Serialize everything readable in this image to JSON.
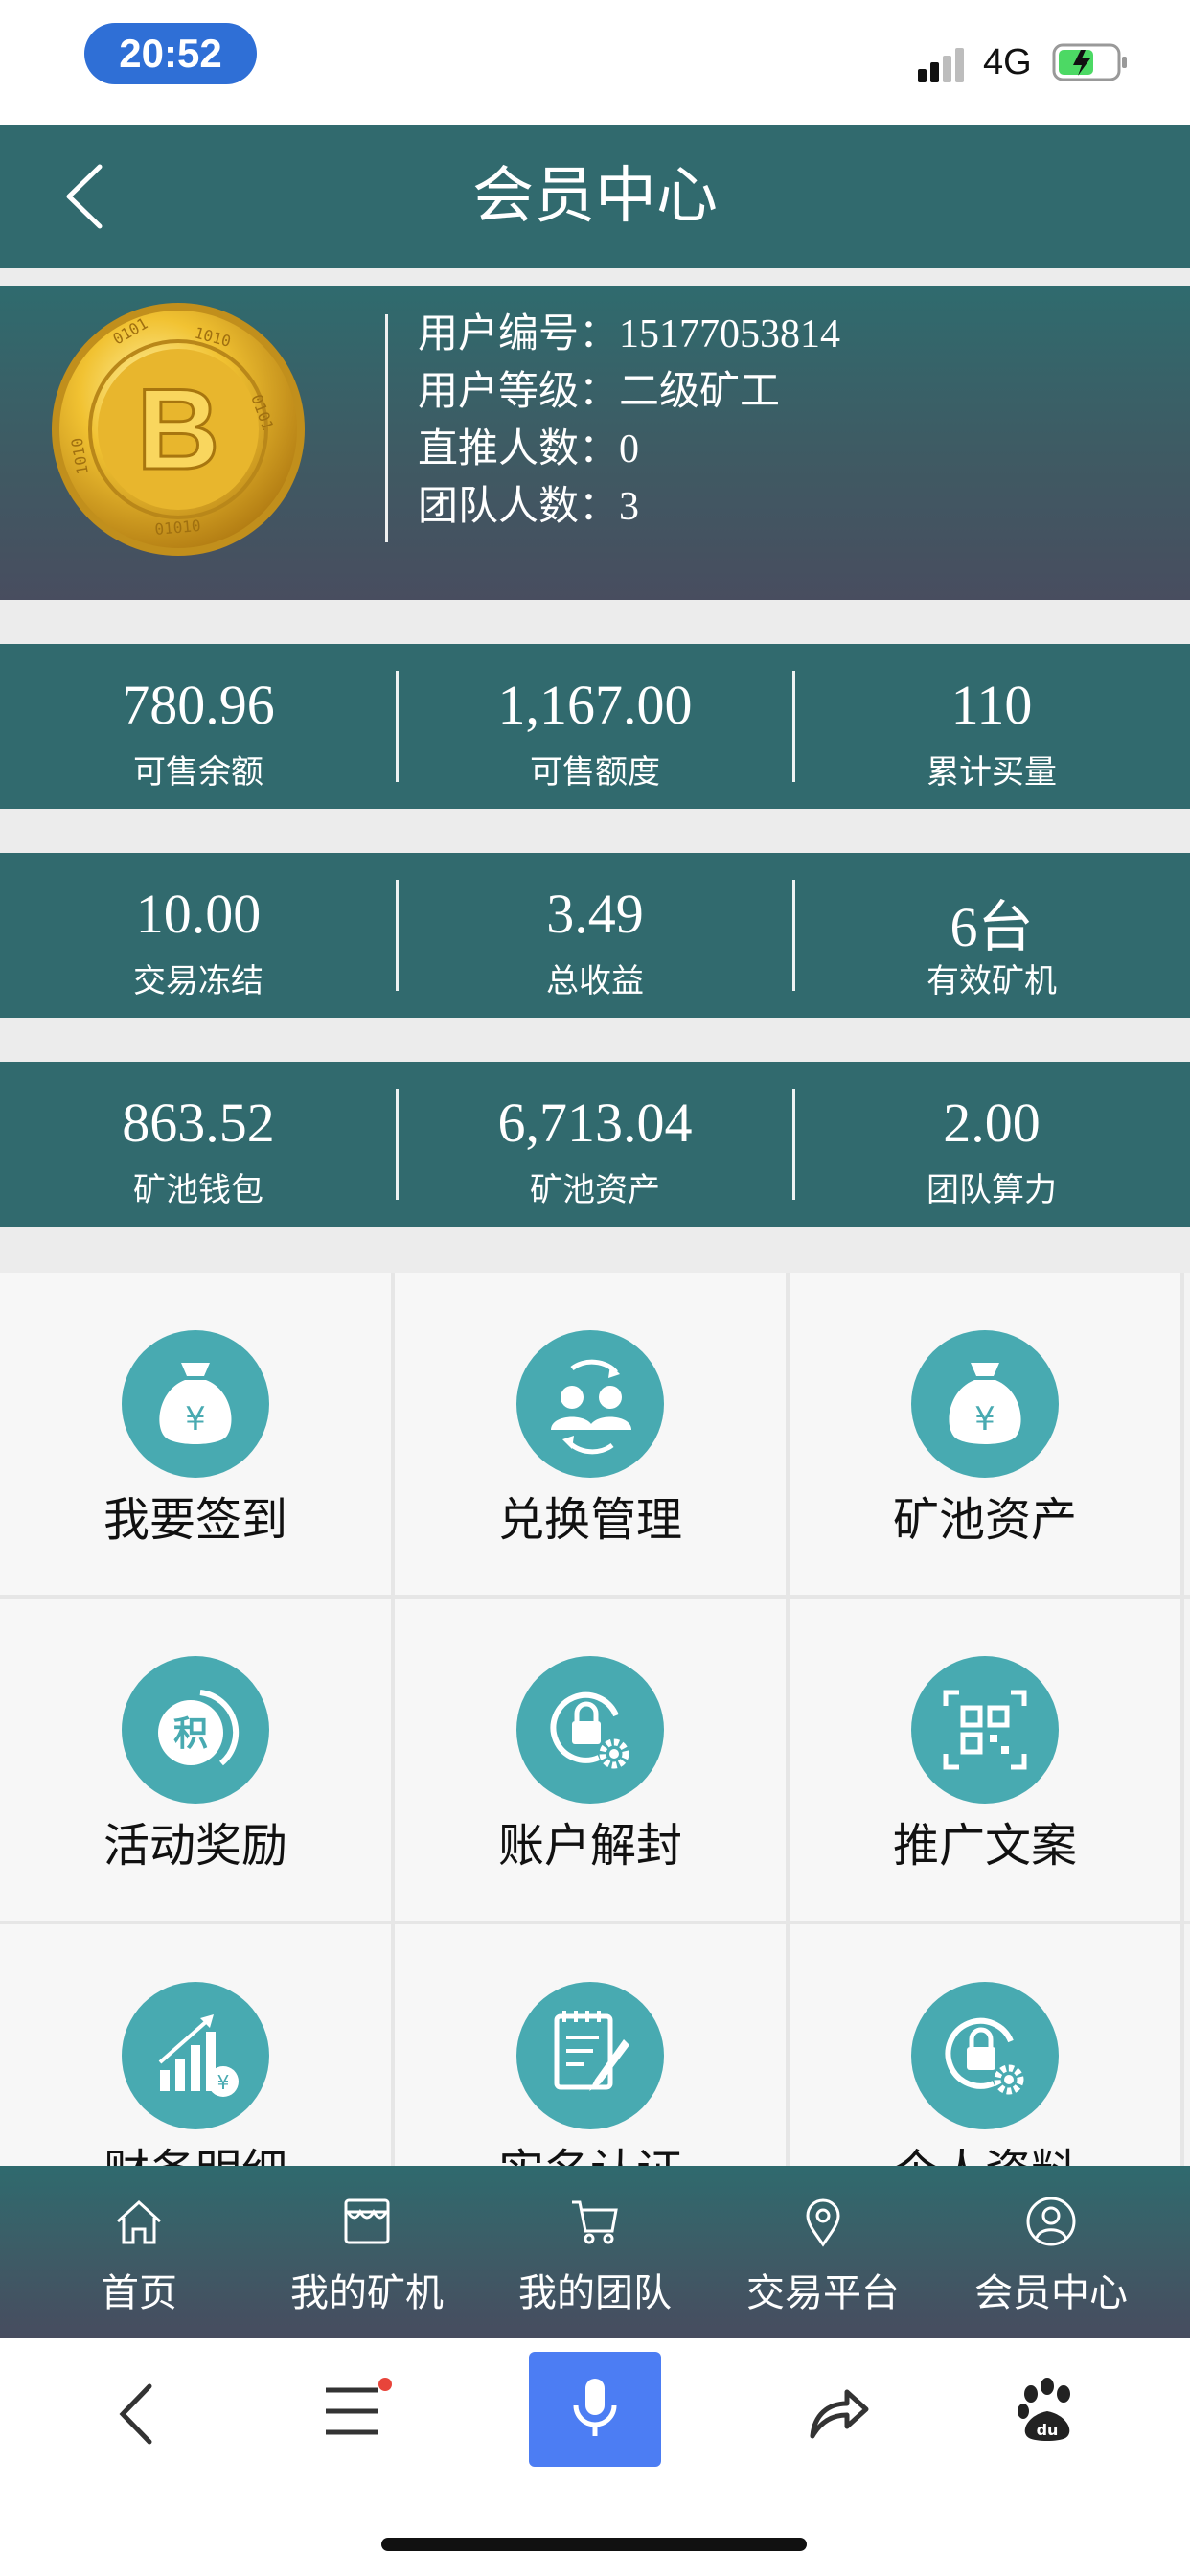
{
  "status_bar": {
    "time": "20:52",
    "network": "4G"
  },
  "header": {
    "title": "会员中心"
  },
  "profile": {
    "lines": [
      {
        "label": "用户编号：",
        "value": "15177053814"
      },
      {
        "label": "用户等级：",
        "value": "二级矿工"
      },
      {
        "label": "直推人数：",
        "value": "0"
      },
      {
        "label": "团队人数：",
        "value": "3"
      }
    ]
  },
  "stats": [
    [
      {
        "value": "780.96",
        "label": "可售余额"
      },
      {
        "value": "1,167.00",
        "label": "可售额度"
      },
      {
        "value": "110",
        "label": "累计买量"
      }
    ],
    [
      {
        "value": "10.00",
        "label": "交易冻结"
      },
      {
        "value": "3.49",
        "label": "总收益"
      },
      {
        "value": "6台",
        "label": "有效矿机"
      }
    ],
    [
      {
        "value": "863.52",
        "label": "矿池钱包"
      },
      {
        "value": "6,713.04",
        "label": "矿池资产"
      },
      {
        "value": "2.00",
        "label": "团队算力"
      }
    ]
  ],
  "grid": [
    {
      "label": "我要签到",
      "icon": "money-bag-icon"
    },
    {
      "label": "兑换管理",
      "icon": "exchange-users-icon"
    },
    {
      "label": "矿池资产",
      "icon": "money-bag-icon"
    },
    {
      "label": "活动奖励",
      "icon": "points-icon"
    },
    {
      "label": "账户解封",
      "icon": "lock-gear-icon"
    },
    {
      "label": "推广文案",
      "icon": "qr-code-icon"
    },
    {
      "label": "财务明细",
      "icon": "finance-chart-icon"
    },
    {
      "label": "实名认证",
      "icon": "document-edit-icon"
    },
    {
      "label": "个人资料",
      "icon": "lock-gear-icon"
    }
  ],
  "tabbar": [
    {
      "label": "首页",
      "icon": "home-icon"
    },
    {
      "label": "我的矿机",
      "icon": "store-icon"
    },
    {
      "label": "我的团队",
      "icon": "cart-icon"
    },
    {
      "label": "交易平台",
      "icon": "location-icon"
    },
    {
      "label": "会员中心",
      "icon": "user-icon"
    }
  ],
  "colors": {
    "primary": "#316a6e",
    "icon_circle": "#48aab1",
    "mic": "#4c7df3"
  }
}
